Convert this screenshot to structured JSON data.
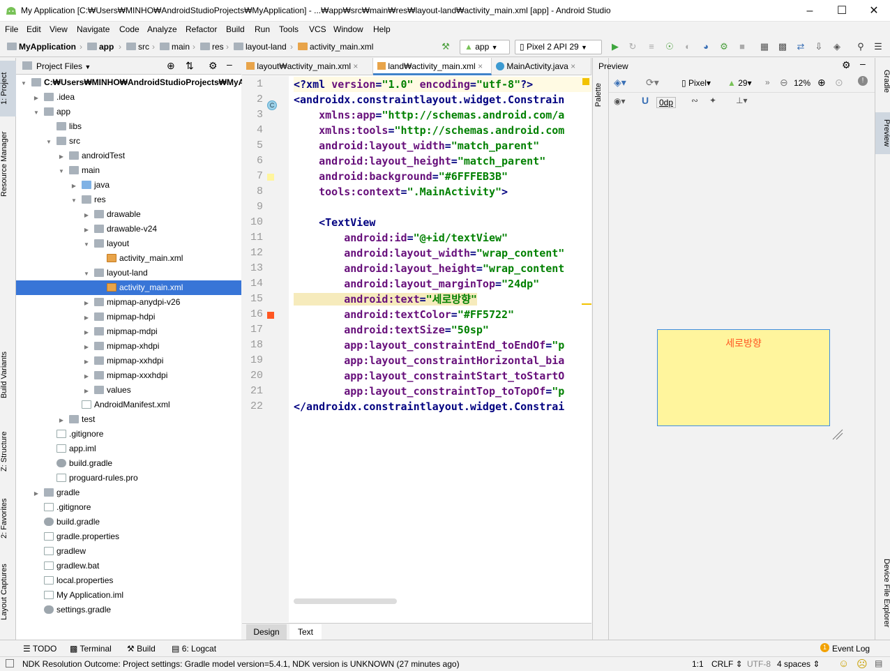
{
  "window": {
    "title": "My Application [C:₩Users₩MINHO₩AndroidStudioProjects₩MyApplication] - ...₩app₩src₩main₩res₩layout-land₩activity_main.xml [app] - Android Studio"
  },
  "menu": [
    "File",
    "Edit",
    "View",
    "Navigate",
    "Code",
    "Analyze",
    "Refactor",
    "Build",
    "Run",
    "Tools",
    "VCS",
    "Window",
    "Help"
  ],
  "breadcrumb": [
    "MyApplication",
    "app",
    "src",
    "main",
    "res",
    "layout-land",
    "activity_main.xml"
  ],
  "toolbar": {
    "config": "app",
    "device": "Pixel 2 API 29"
  },
  "left_tabs": [
    "1: Project",
    "Resource Manager",
    "Build Variants",
    "Z: Structure",
    "2: Favorites",
    "Layout Captures"
  ],
  "right_tabs": [
    "Gradle",
    "Preview",
    "Device File Explorer"
  ],
  "project": {
    "header": "Project Files",
    "tree": [
      {
        "label": "C:₩Users₩MINHO₩AndroidStudioProjects₩MyAp",
        "depth": 0,
        "arrow": "▼",
        "icon": "folder",
        "bold": true
      },
      {
        "label": ".idea",
        "depth": 1,
        "arrow": "▶",
        "icon": "folder"
      },
      {
        "label": "app",
        "depth": 1,
        "arrow": "▼",
        "icon": "folder"
      },
      {
        "label": "libs",
        "depth": 2,
        "arrow": "",
        "icon": "folder"
      },
      {
        "label": "src",
        "depth": 2,
        "arrow": "▼",
        "icon": "folder"
      },
      {
        "label": "androidTest",
        "depth": 3,
        "arrow": "▶",
        "icon": "folder"
      },
      {
        "label": "main",
        "depth": 3,
        "arrow": "▼",
        "icon": "folder"
      },
      {
        "label": "java",
        "depth": 4,
        "arrow": "▶",
        "icon": "folder blue"
      },
      {
        "label": "res",
        "depth": 4,
        "arrow": "▼",
        "icon": "folder"
      },
      {
        "label": "drawable",
        "depth": 5,
        "arrow": "▶",
        "icon": "folder"
      },
      {
        "label": "drawable-v24",
        "depth": 5,
        "arrow": "▶",
        "icon": "folder"
      },
      {
        "label": "layout",
        "depth": 5,
        "arrow": "▼",
        "icon": "folder"
      },
      {
        "label": "activity_main.xml",
        "depth": 6,
        "arrow": "",
        "icon": "xml"
      },
      {
        "label": "layout-land",
        "depth": 5,
        "arrow": "▼",
        "icon": "folder"
      },
      {
        "label": "activity_main.xml",
        "depth": 6,
        "arrow": "",
        "icon": "xml",
        "selected": true
      },
      {
        "label": "mipmap-anydpi-v26",
        "depth": 5,
        "arrow": "▶",
        "icon": "folder"
      },
      {
        "label": "mipmap-hdpi",
        "depth": 5,
        "arrow": "▶",
        "icon": "folder"
      },
      {
        "label": "mipmap-mdpi",
        "depth": 5,
        "arrow": "▶",
        "icon": "folder"
      },
      {
        "label": "mipmap-xhdpi",
        "depth": 5,
        "arrow": "▶",
        "icon": "folder"
      },
      {
        "label": "mipmap-xxhdpi",
        "depth": 5,
        "arrow": "▶",
        "icon": "folder"
      },
      {
        "label": "mipmap-xxxhdpi",
        "depth": 5,
        "arrow": "▶",
        "icon": "folder"
      },
      {
        "label": "values",
        "depth": 5,
        "arrow": "▶",
        "icon": "folder"
      },
      {
        "label": "AndroidManifest.xml",
        "depth": 4,
        "arrow": "",
        "icon": "file"
      },
      {
        "label": "test",
        "depth": 3,
        "arrow": "▶",
        "icon": "folder"
      },
      {
        "label": ".gitignore",
        "depth": 2,
        "arrow": "",
        "icon": "file"
      },
      {
        "label": "app.iml",
        "depth": 2,
        "arrow": "",
        "icon": "file"
      },
      {
        "label": "build.gradle",
        "depth": 2,
        "arrow": "",
        "icon": "gradle"
      },
      {
        "label": "proguard-rules.pro",
        "depth": 2,
        "arrow": "",
        "icon": "file"
      },
      {
        "label": "gradle",
        "depth": 1,
        "arrow": "▶",
        "icon": "folder"
      },
      {
        "label": ".gitignore",
        "depth": 1,
        "arrow": "",
        "icon": "file"
      },
      {
        "label": "build.gradle",
        "depth": 1,
        "arrow": "",
        "icon": "gradle"
      },
      {
        "label": "gradle.properties",
        "depth": 1,
        "arrow": "",
        "icon": "file"
      },
      {
        "label": "gradlew",
        "depth": 1,
        "arrow": "",
        "icon": "file"
      },
      {
        "label": "gradlew.bat",
        "depth": 1,
        "arrow": "",
        "icon": "file"
      },
      {
        "label": "local.properties",
        "depth": 1,
        "arrow": "",
        "icon": "file"
      },
      {
        "label": "My Application.iml",
        "depth": 1,
        "arrow": "",
        "icon": "file"
      },
      {
        "label": "settings.gradle",
        "depth": 1,
        "arrow": "",
        "icon": "gradle"
      }
    ]
  },
  "editor": {
    "tabs": [
      {
        "label": "layout₩activity_main.xml"
      },
      {
        "label": "land₩activity_main.xml",
        "active": true
      },
      {
        "label": "MainActivity.java"
      }
    ],
    "lines": [
      [
        [
          "t",
          "<?xml "
        ],
        [
          "a",
          "version"
        ],
        [
          "n",
          "="
        ],
        [
          "v",
          "\"1.0\""
        ],
        [
          "n",
          " "
        ],
        [
          "a",
          "encoding"
        ],
        [
          "n",
          "="
        ],
        [
          "v",
          "\"utf-8\""
        ],
        [
          "t",
          "?>"
        ]
      ],
      [
        [
          "t",
          "<androidx.constraintlayout.widget.Constrain"
        ]
      ],
      [
        [
          "n",
          "    "
        ],
        [
          "a",
          "xmlns:app"
        ],
        [
          "n",
          "="
        ],
        [
          "v",
          "\"http://schemas.android.com/a"
        ]
      ],
      [
        [
          "n",
          "    "
        ],
        [
          "a",
          "xmlns:tools"
        ],
        [
          "n",
          "="
        ],
        [
          "v",
          "\"http://schemas.android.com"
        ]
      ],
      [
        [
          "n",
          "    "
        ],
        [
          "a",
          "android:layout_width"
        ],
        [
          "n",
          "="
        ],
        [
          "v",
          "\"match_parent\""
        ]
      ],
      [
        [
          "n",
          "    "
        ],
        [
          "a",
          "android:layout_height"
        ],
        [
          "n",
          "="
        ],
        [
          "v",
          "\"match_parent\""
        ]
      ],
      [
        [
          "n",
          "    "
        ],
        [
          "a",
          "android:background"
        ],
        [
          "n",
          "="
        ],
        [
          "v",
          "\"#6FFFEB3B\""
        ]
      ],
      [
        [
          "n",
          "    "
        ],
        [
          "a",
          "tools:context"
        ],
        [
          "n",
          "="
        ],
        [
          "v",
          "\".MainActivity\""
        ],
        [
          "t",
          ">"
        ]
      ],
      [],
      [
        [
          "n",
          "    "
        ],
        [
          "t",
          "<TextView"
        ]
      ],
      [
        [
          "n",
          "        "
        ],
        [
          "a",
          "android:id"
        ],
        [
          "n",
          "="
        ],
        [
          "v",
          "\"@+id/textView\""
        ]
      ],
      [
        [
          "n",
          "        "
        ],
        [
          "a",
          "android:layout_width"
        ],
        [
          "n",
          "="
        ],
        [
          "v",
          "\"wrap_content\""
        ]
      ],
      [
        [
          "n",
          "        "
        ],
        [
          "a",
          "android:layout_height"
        ],
        [
          "n",
          "="
        ],
        [
          "v",
          "\"wrap_content"
        ]
      ],
      [
        [
          "n",
          "        "
        ],
        [
          "a",
          "android:layout_marginTop"
        ],
        [
          "n",
          "="
        ],
        [
          "v",
          "\"24dp\""
        ]
      ],
      [
        [
          "n",
          "        "
        ],
        [
          "a",
          "android:text"
        ],
        [
          "n",
          "="
        ],
        [
          "v",
          "\"세로방향\""
        ]
      ],
      [
        [
          "n",
          "        "
        ],
        [
          "a",
          "android:textColor"
        ],
        [
          "n",
          "="
        ],
        [
          "v",
          "\"#FF5722\""
        ]
      ],
      [
        [
          "n",
          "        "
        ],
        [
          "a",
          "android:textSize"
        ],
        [
          "n",
          "="
        ],
        [
          "v",
          "\"50sp\""
        ]
      ],
      [
        [
          "n",
          "        "
        ],
        [
          "a",
          "app:layout_constraintEnd_toEndOf"
        ],
        [
          "n",
          "="
        ],
        [
          "v",
          "\"p"
        ]
      ],
      [
        [
          "n",
          "        "
        ],
        [
          "a",
          "app:layout_constraintHorizontal_bia"
        ]
      ],
      [
        [
          "n",
          "        "
        ],
        [
          "a",
          "app:layout_constraintStart_toStartO"
        ]
      ],
      [
        [
          "n",
          "        "
        ],
        [
          "a",
          "app:layout_constraintTop_toTopOf"
        ],
        [
          "n",
          "="
        ],
        [
          "v",
          "\"p"
        ]
      ],
      [
        [
          "t",
          "</androidx.constraintlayout.widget.Constrai"
        ]
      ]
    ],
    "bottom_tabs": [
      "Design",
      "Text"
    ],
    "palette_label": "Palette"
  },
  "preview": {
    "title": "Preview",
    "device": "Pixel",
    "api": "29",
    "zoom": "12%",
    "margin": "0dp",
    "text": "세로방향",
    "bg_color": "#FFF59D",
    "text_color": "#FF5722"
  },
  "toolwindows": [
    "TODO",
    "Terminal",
    "Build",
    "6: Logcat"
  ],
  "event_log": "Event Log",
  "event_count": "1",
  "status": {
    "message": "NDK Resolution Outcome: Project settings: Gradle model version=5.4.1, NDK version is UNKNOWN (27 minutes ago)",
    "position": "1:1",
    "line_sep": "CRLF",
    "encoding": "UTF-8",
    "indent": "4 spaces"
  }
}
